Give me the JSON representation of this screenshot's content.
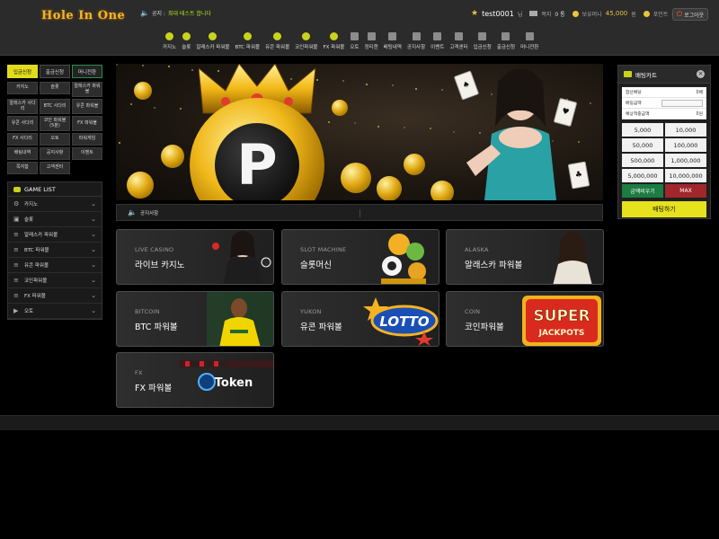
{
  "header": {
    "logo": "Hole In One",
    "notice_label": "공지 :",
    "notice_text": "최대 테스트 합니다",
    "username": "test0001",
    "username_suffix": "님",
    "messages_label": "쪽지",
    "messages_count": "0 통",
    "money_label": "보유머니",
    "money_value": "45,000",
    "money_unit": "원",
    "point_label": "포인트",
    "point_value": "0원",
    "logout_label": "로그아웃"
  },
  "nav": [
    {
      "label": "카지노",
      "icon": "coin-icon"
    },
    {
      "label": "슬롯",
      "icon": "slot-icon"
    },
    {
      "label": "알래스카 파워볼",
      "icon": "powerball-icon"
    },
    {
      "label": "BTC 파워볼",
      "icon": "powerball-icon"
    },
    {
      "label": "유콘 파워볼",
      "icon": "powerball-icon"
    },
    {
      "label": "코인파워볼",
      "icon": "powerball-icon"
    },
    {
      "label": "FX 파워볼",
      "icon": "powerball-icon"
    },
    {
      "label": "오토",
      "icon": "video-icon"
    },
    {
      "label": "정티캔",
      "icon": "grid-icon"
    },
    {
      "label": "배팅내역",
      "icon": "list-icon"
    },
    {
      "label": "공지사항",
      "icon": "doc-icon"
    },
    {
      "label": "이벤트",
      "icon": "calendar-icon"
    },
    {
      "label": "고객센터",
      "icon": "support-icon"
    },
    {
      "label": "입금신청",
      "icon": "deposit-icon"
    },
    {
      "label": "출금신청",
      "icon": "withdraw-icon"
    },
    {
      "label": "머니전환",
      "icon": "exchange-icon"
    }
  ],
  "left": {
    "tabs": [
      "입금신청",
      "출금신청",
      "머니전환"
    ],
    "grid": [
      "카지노",
      "슬롯",
      "알래스카 파워볼",
      "알래스카 사다리",
      "BTC 사다리",
      "유콘 파워볼",
      "유콘 사다리",
      "코인 파워볼 (5분)",
      "FX 파워볼",
      "FX 사다리",
      "오토",
      "파워게임",
      "배팅내역",
      "공지사항",
      "이벤트",
      "쪽지함",
      "고객센터"
    ],
    "game_list_title": "GAME LIST",
    "game_list": [
      {
        "label": "카지노",
        "icon": "casino-icon"
      },
      {
        "label": "슬롯",
        "icon": "slot-icon"
      },
      {
        "label": "알래스카 파워볼",
        "icon": "list-icon"
      },
      {
        "label": "BTC 파워볼",
        "icon": "list-icon"
      },
      {
        "label": "유콘 파워볼",
        "icon": "list-icon"
      },
      {
        "label": "코인파워볼",
        "icon": "list-icon"
      },
      {
        "label": "FX 파워볼",
        "icon": "list-icon"
      },
      {
        "label": "오토",
        "icon": "video-icon"
      }
    ]
  },
  "announcement": {
    "label": "공지사항"
  },
  "game_cards": [
    {
      "en": "LIVE CASINO",
      "ko": "라이브 카지노"
    },
    {
      "en": "SLOT MACHINE",
      "ko": "슬롯머신"
    },
    {
      "en": "ALASKA",
      "ko": "알래스카 파워볼"
    },
    {
      "en": "BITCOIN",
      "ko": "BTC 파워볼"
    },
    {
      "en": "YUKON",
      "ko": "유콘 파워볼"
    },
    {
      "en": "COIN",
      "ko": "코인파워볼"
    },
    {
      "en": "FX",
      "ko": "FX 파워볼"
    }
  ],
  "card_art": {
    "lotto": "LOTTO",
    "super": "SUPER",
    "jackpots": "JACKPOTS",
    "token": "Token"
  },
  "bet_cart": {
    "title": "배팅카트",
    "rows": [
      {
        "label": "합산배당",
        "value": "0배"
      },
      {
        "label": "배팅금액",
        "value": ""
      },
      {
        "label": "예상적중금액",
        "value": "0원"
      }
    ],
    "amounts": [
      "5,000",
      "10,000",
      "50,000",
      "100,000",
      "500,000",
      "1,000,000",
      "5,000,000",
      "10,000,000"
    ],
    "reset_label": "금액비우기",
    "max_label": "MAX",
    "bet_label": "배팅하기"
  }
}
